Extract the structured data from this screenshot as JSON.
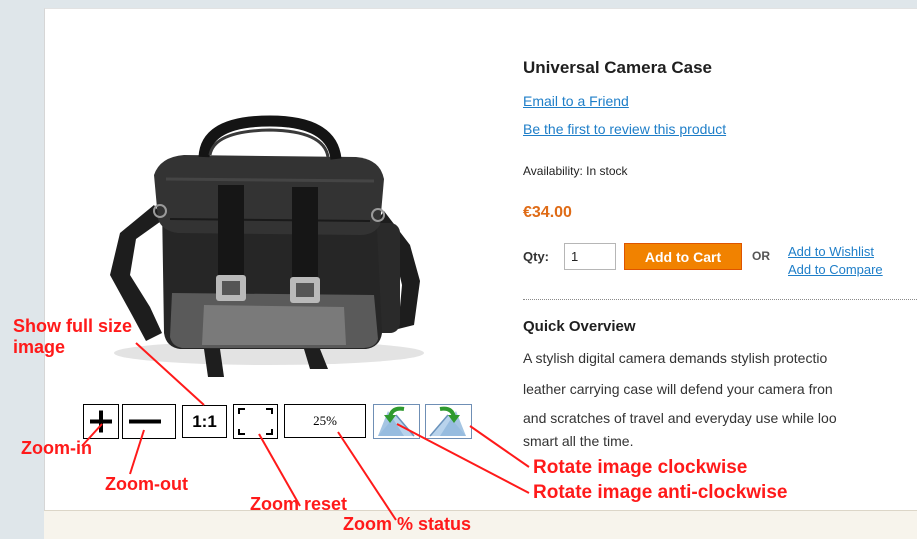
{
  "product": {
    "name": "Universal Camera Case",
    "email_friend": "Email to a Friend",
    "review_link": "Be the first to review this product",
    "availability": "Availability: In stock",
    "price": "€34.00",
    "qty_label": "Qty:",
    "qty_value": "1",
    "add_to_cart": "Add to Cart",
    "or_label": "OR",
    "add_to_wishlist": "Add to Wishlist",
    "add_to_compare": "Add to Compare",
    "overview_title": "Quick Overview",
    "overview_lines": [
      "A stylish digital camera demands stylish protectio",
      "leather carrying case will defend your camera fron",
      "and scratches of travel and everyday use while loo",
      "smart all the time."
    ]
  },
  "toolbar": {
    "zoom_in_icon": "plus-icon",
    "zoom_out_icon": "minus-icon",
    "actual_size_label": "1:1",
    "reset_icon": "dashed-frame-icon",
    "zoom_status": "25%",
    "rotate_ccw_icon": "rotate-left-arrow-icon",
    "rotate_cw_icon": "rotate-right-arrow-icon"
  },
  "annotations": {
    "show_full_size_line1": "Show full size",
    "show_full_size_line2": "image",
    "zoom_in": "Zoom-in",
    "zoom_out": "Zoom-out",
    "zoom_reset": "Zoom reset",
    "zoom_status": "Zoom % status",
    "rotate_cw": "Rotate image clockwise",
    "rotate_ccw": "Rotate image anti-clockwise"
  },
  "colors": {
    "link": "#1e7ec8",
    "price": "#df6b16",
    "button": "#f18200",
    "annotation": "#ff1a1a"
  }
}
